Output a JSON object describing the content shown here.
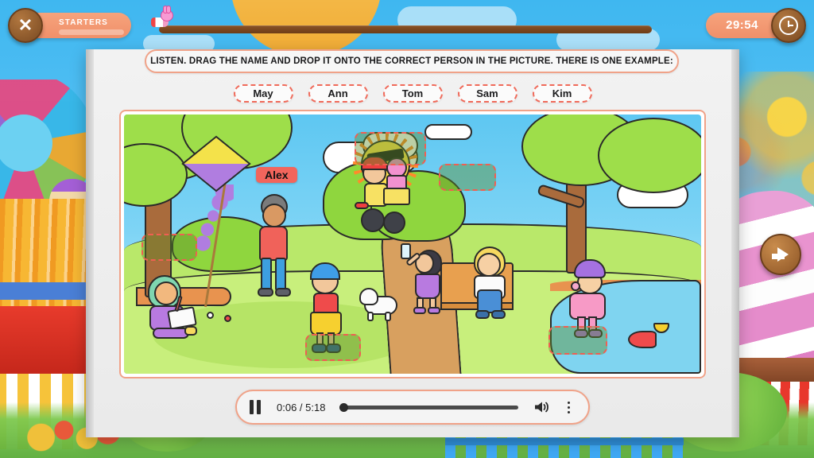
{
  "topbar": {
    "close_icon": "close-x-icon",
    "level_label": "STARTERS",
    "timer_value": "29:54",
    "clock_icon": "clock-icon",
    "progress_marker_icon": "rocket-bunny-icon",
    "progress_percent": 0
  },
  "instruction": {
    "text": "LISTEN. DRAG THE NAME AND DROP IT ONTO THE CORRECT PERSON IN THE PICTURE. THERE IS ONE EXAMPLE:"
  },
  "name_chips": [
    {
      "label": "May"
    },
    {
      "label": "Ann"
    },
    {
      "label": "Tom"
    },
    {
      "label": "Sam"
    },
    {
      "label": "Kim"
    }
  ],
  "picture": {
    "example_answer": {
      "label": "Alex"
    },
    "dropzones": [
      {
        "id": "dropzone-girl-drawing"
      },
      {
        "id": "dropzone-boy-cap"
      },
      {
        "id": "dropzone-cyclist"
      },
      {
        "id": "dropzone-bench-kids"
      },
      {
        "id": "dropzone-pond-girl"
      }
    ],
    "scene_elements": [
      "tree-left",
      "kite",
      "boy-with-kite-string",
      "cloud",
      "cyclist-with-cat",
      "sun-with-sunglasses",
      "bush",
      "girl-taking-selfie",
      "girl-on-bench",
      "tree-right",
      "white-dog",
      "girl-drawing",
      "boy-with-blue-cap",
      "girl-at-pond",
      "fish",
      "paper-boat",
      "path",
      "pond"
    ]
  },
  "player": {
    "play_pause_icon": "pause-icon",
    "time_display": "0:06 / 5:18",
    "current_time": "0:06",
    "duration": "5:18",
    "progress_percent": 2,
    "volume_icon": "volume-high-icon",
    "menu_icon": "kebab-menu-icon"
  },
  "navigation": {
    "next_icon": "arrow-right-icon"
  },
  "colors": {
    "accent_orange": "#f0906a",
    "chip_border": "#f06a5a",
    "answer_chip_bg": "#f2655c",
    "dropzone_border": "#ef5f52",
    "wood_button": "#8d5526",
    "sky": "#5ec4f5"
  }
}
